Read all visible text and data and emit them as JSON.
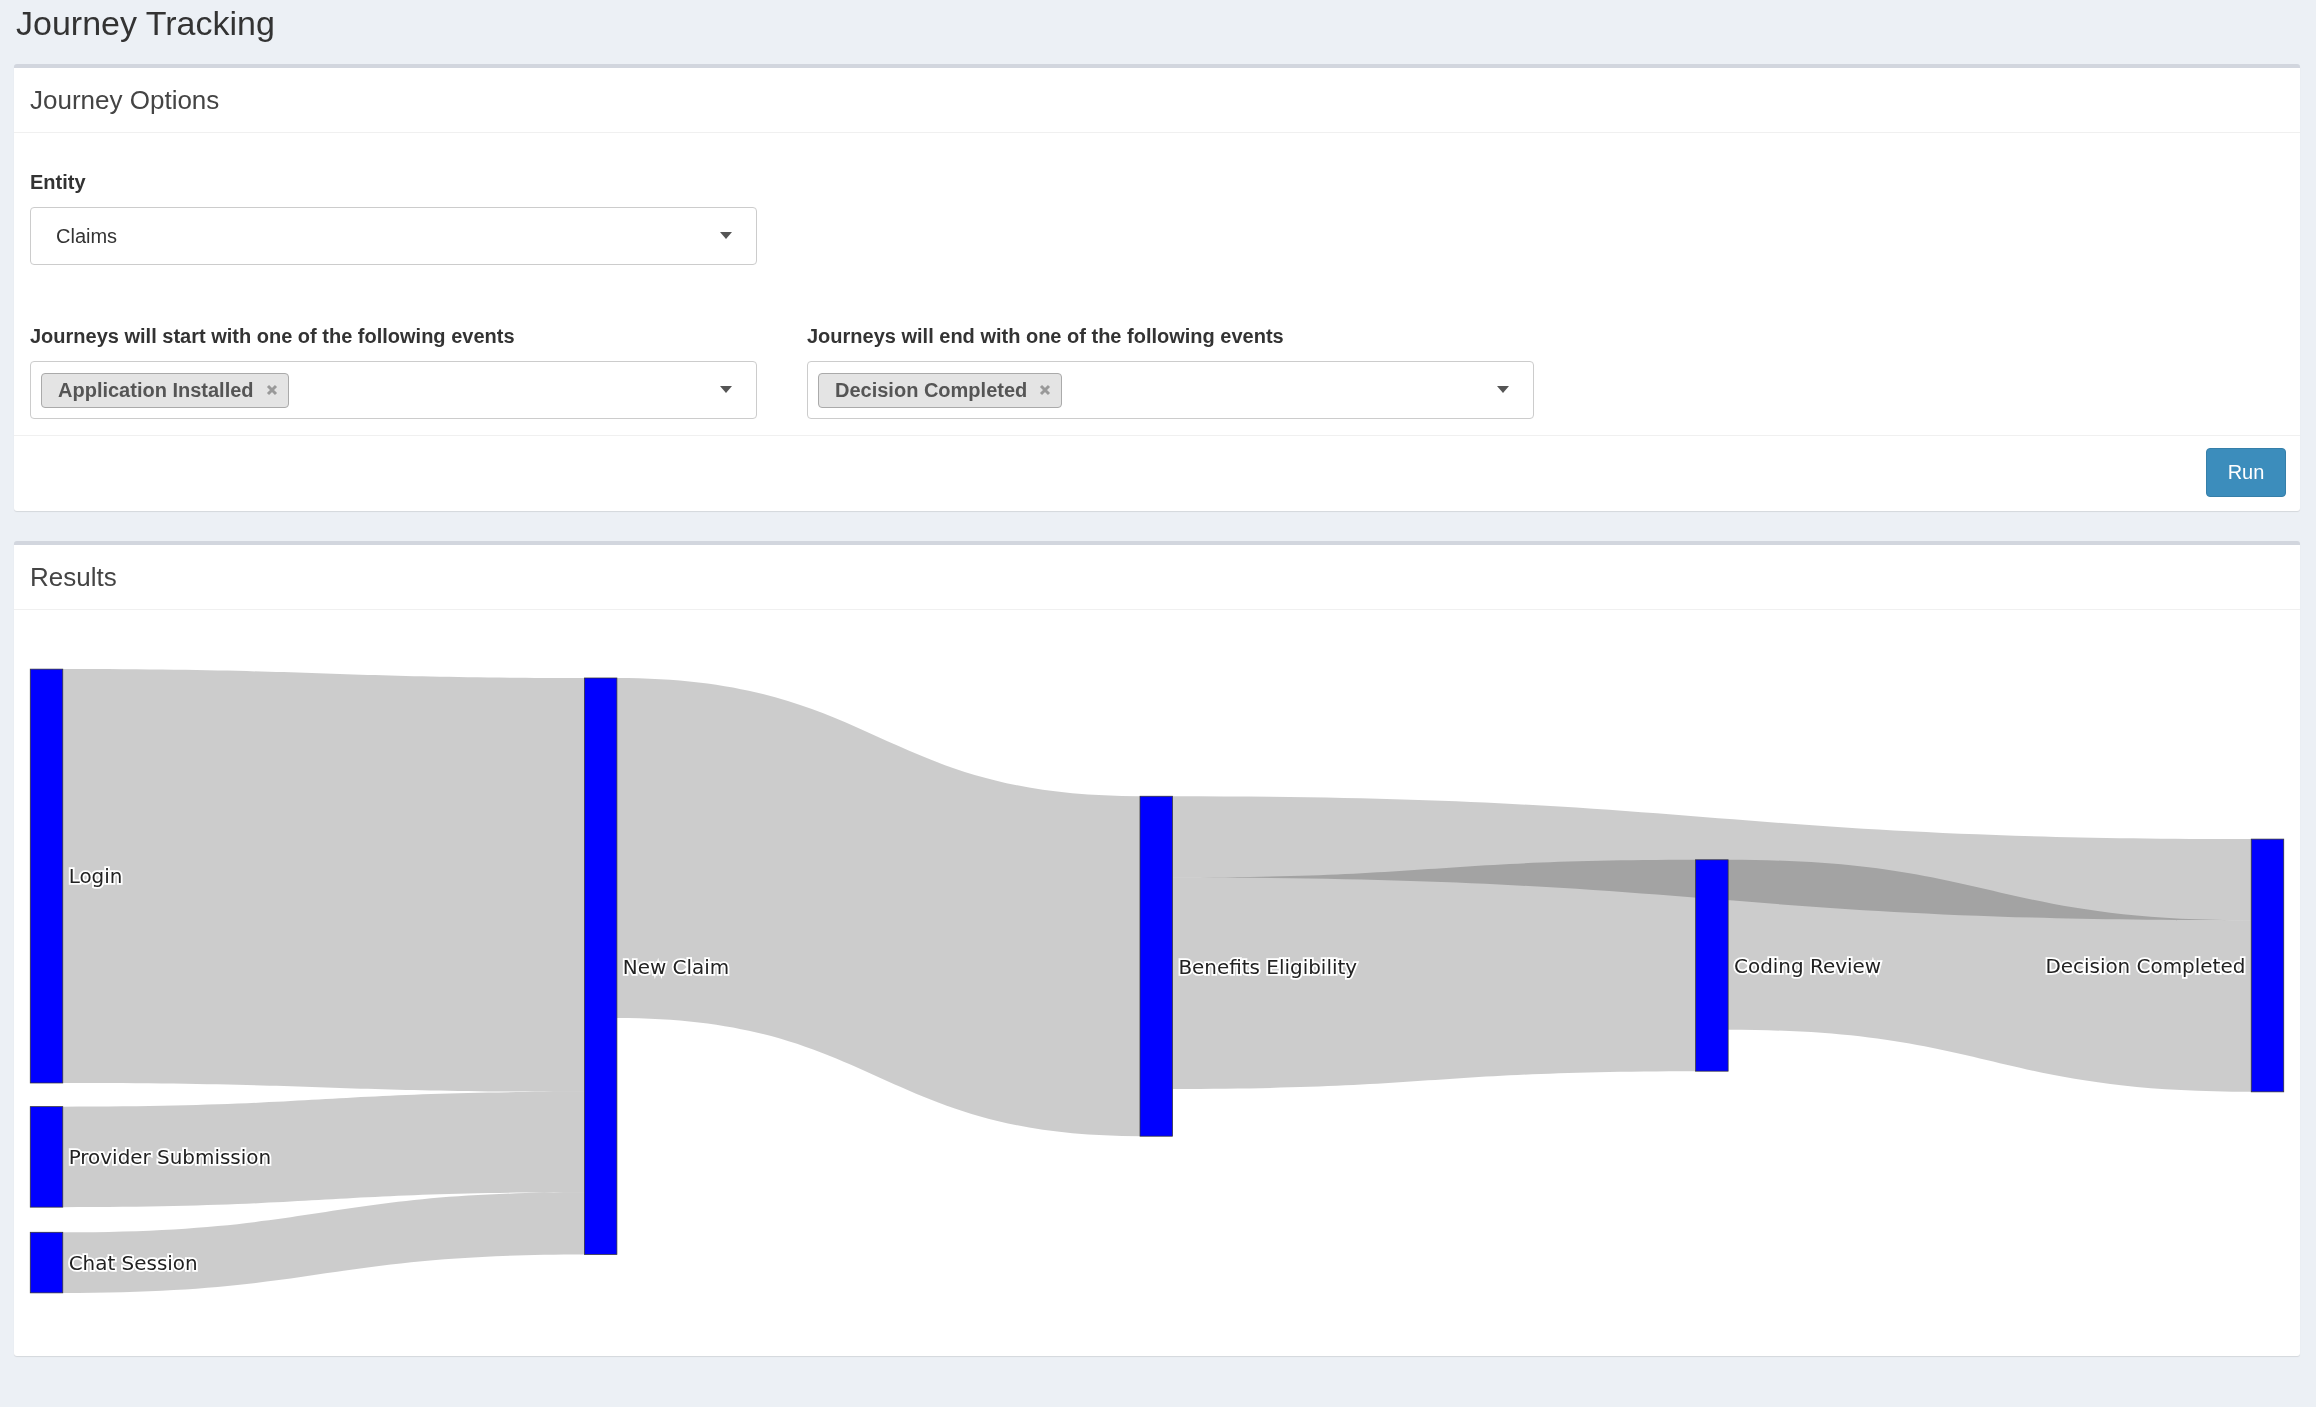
{
  "page_title": "Journey Tracking",
  "options_panel": {
    "title": "Journey Options",
    "entity": {
      "label": "Entity",
      "value": "Claims"
    },
    "start_events": {
      "label": "Journeys will start with one of the following events",
      "tags": [
        "Application Installed"
      ]
    },
    "end_events": {
      "label": "Journeys will end with one of the following events",
      "tags": [
        "Decision Completed"
      ]
    },
    "run_button": "Run"
  },
  "results_panel": {
    "title": "Results",
    "nodes": [
      {
        "label": "Login"
      },
      {
        "label": "Provider Submission"
      },
      {
        "label": "Chat Session"
      },
      {
        "label": "New Claim"
      },
      {
        "label": "Benefits Eligibility"
      },
      {
        "label": "Coding Review"
      },
      {
        "label": "Decision Completed"
      }
    ]
  }
}
